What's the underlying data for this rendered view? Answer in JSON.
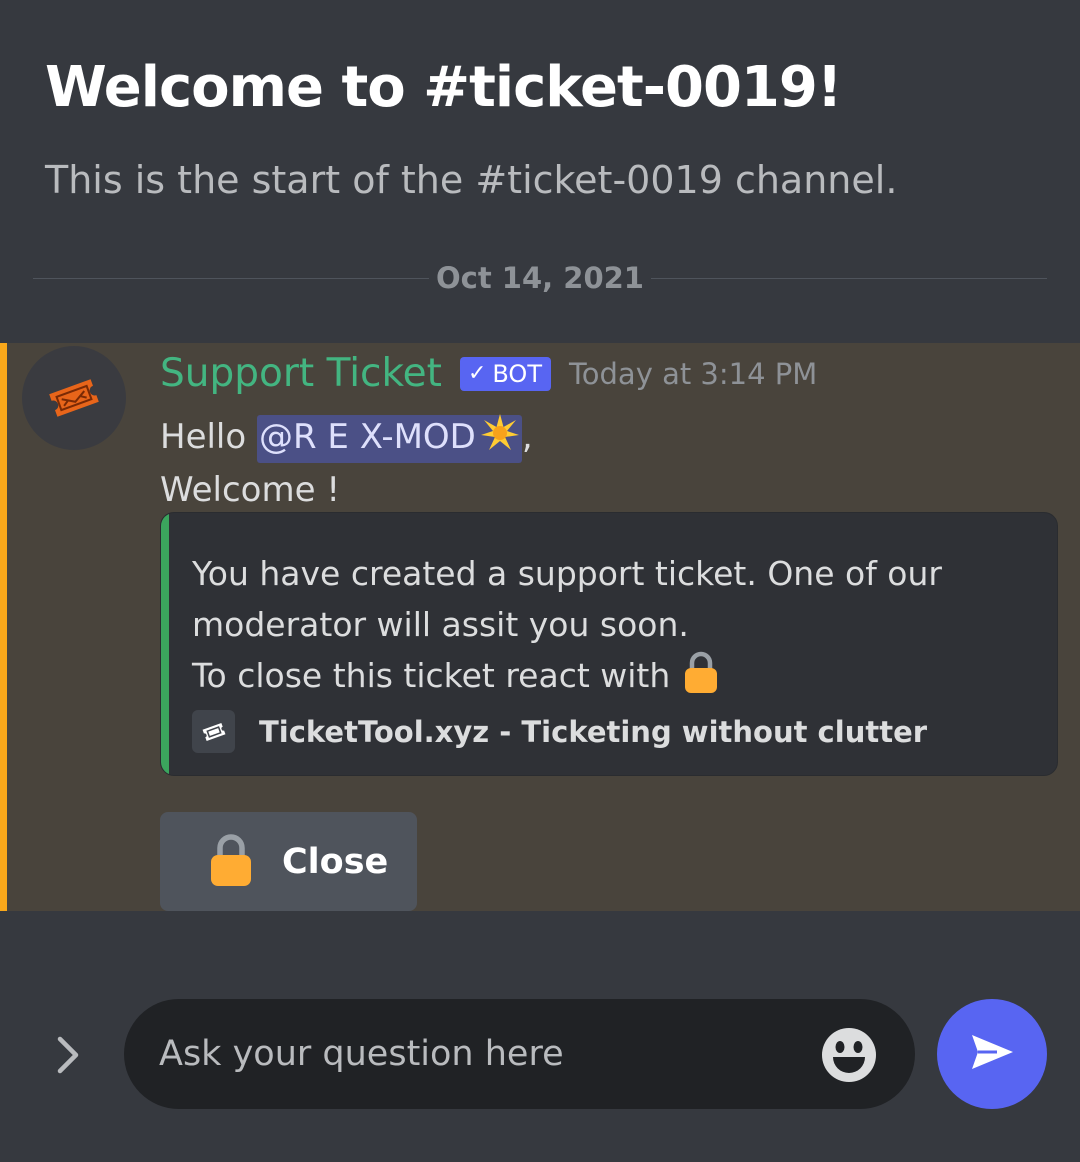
{
  "channel": {
    "welcome_title": "Welcome to #ticket-0019!",
    "welcome_subtitle": "This is the start of the #ticket-0019 channel."
  },
  "divider": {
    "date": "Oct 14, 2021"
  },
  "message": {
    "author": "Support Ticket",
    "bot_tag": "BOT",
    "timestamp": "Today at 3:14 PM",
    "greeting": "Hello ",
    "mention": "@R E X-MOD",
    "mention_emoji": "sparkle",
    "after_mention": ",",
    "welcome": "Welcome !",
    "avatar_icon": "ticket-icon",
    "embed": {
      "line1": "You have created a support ticket. One of our",
      "line2": "moderator will assit you soon.",
      "line3": "To close this ticket react with",
      "footer": "TicketTool.xyz - Ticketing without clutter",
      "accent_color": "#3ba55d"
    },
    "close_button": {
      "label": "Close",
      "icon": "lock-icon"
    }
  },
  "composer": {
    "placeholder": "Ask your question here",
    "expand_icon": "chevron-right-icon",
    "emoji_icon": "smiley-icon",
    "send_icon": "send-icon"
  },
  "colors": {
    "background": "#36393f",
    "mention_highlight": "#49443c",
    "mention_bar": "#faa81a",
    "bot_tag": "#5865f2",
    "author": "#43b581",
    "send_button": "#5865f2"
  }
}
